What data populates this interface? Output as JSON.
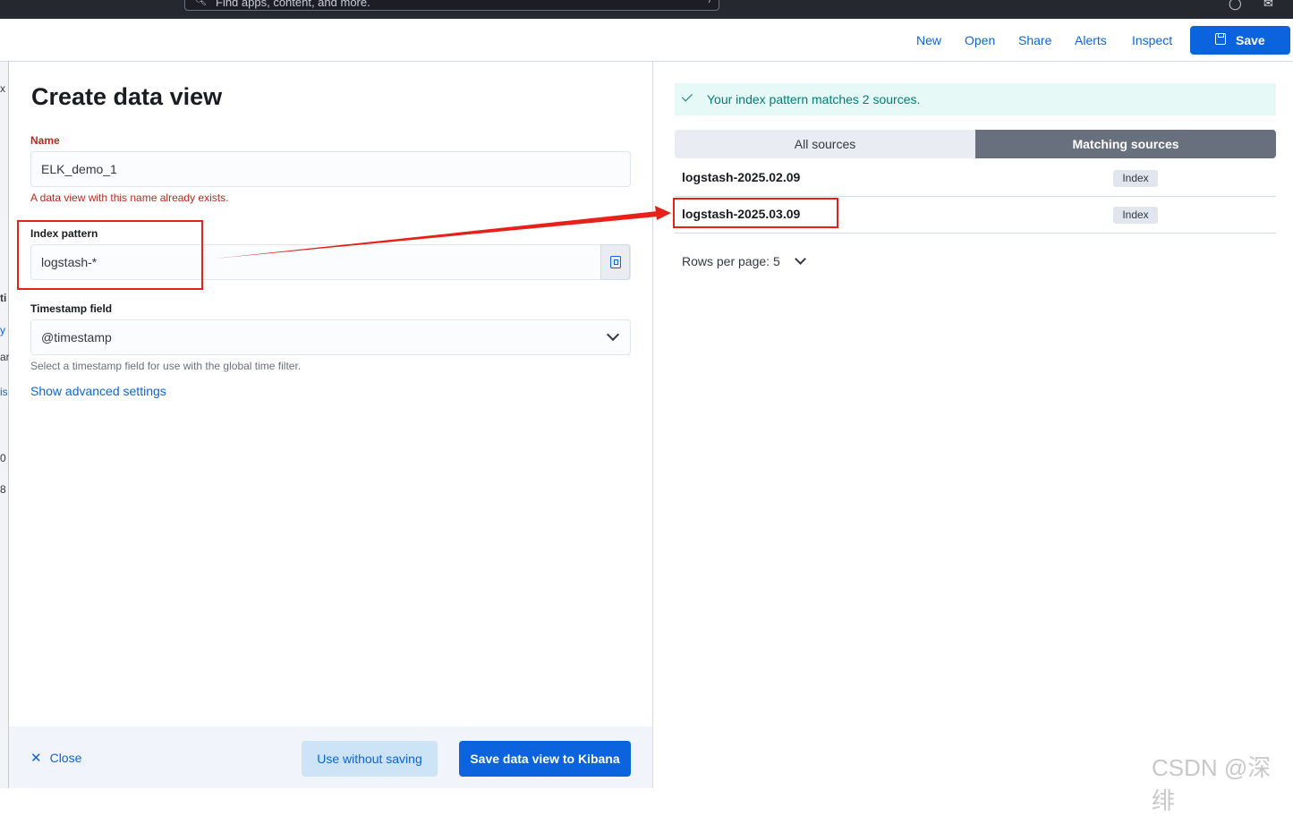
{
  "topbar": {
    "search_placeholder": "Find apps, content, and more.",
    "search_shortcut": "/"
  },
  "header": {
    "links": [
      "New",
      "Open",
      "Share",
      "Alerts",
      "Inspect"
    ],
    "save_label": "Save"
  },
  "background_fragments": [
    "x",
    "ti",
    "y",
    "ar",
    "is",
    "0",
    "8"
  ],
  "form": {
    "title": "Create data view",
    "name_label": "Name",
    "name_value": "ELK_demo_1",
    "name_error": "A data view with this name already exists.",
    "index_label": "Index pattern",
    "index_value": "logstash-*",
    "timestamp_label": "Timestamp field",
    "timestamp_value": "@timestamp",
    "timestamp_help": "Select a timestamp field for use with the global time filter.",
    "advanced_link": "Show advanced settings"
  },
  "footer": {
    "close_label": "Close",
    "use_without_saving": "Use without saving",
    "save_to_kibana": "Save data view to Kibana"
  },
  "sources": {
    "callout": "Your index pattern matches 2 sources.",
    "tab_all": "All sources",
    "tab_matching": "Matching sources",
    "rows": [
      {
        "name": "logstash-2025.02.09",
        "type": "Index"
      },
      {
        "name": "logstash-2025.03.09",
        "type": "Index"
      }
    ],
    "rows_per_page": "Rows per page: 5"
  },
  "annotation_color": "#e8201a",
  "watermark": "CSDN @深绯"
}
